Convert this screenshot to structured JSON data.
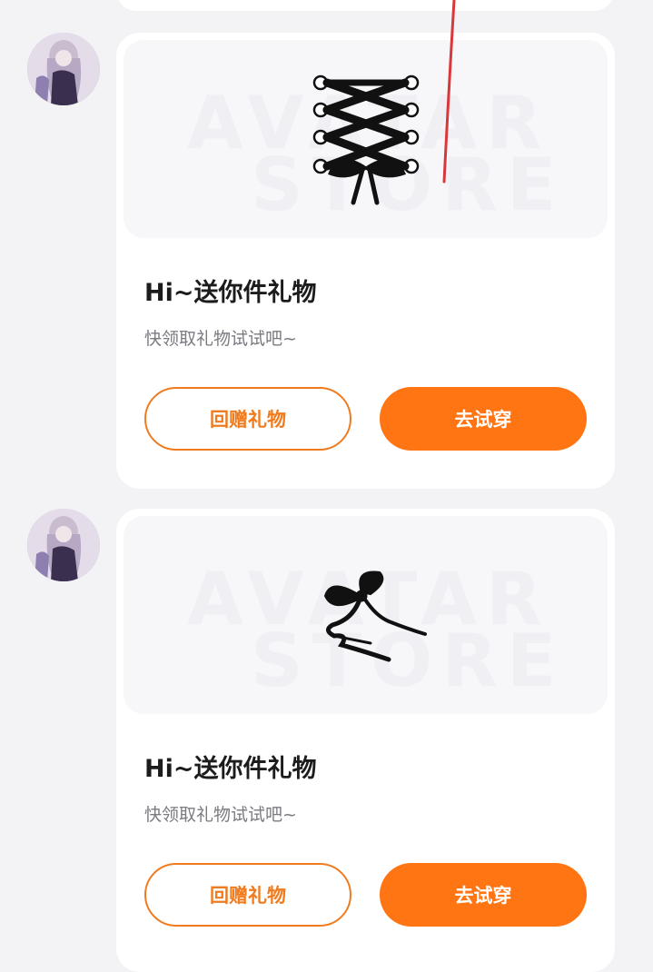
{
  "messages": [
    {
      "avatar_icon": "user-avatar",
      "item_icon": "corset-lace-icon",
      "title": "Hi~送你件礼物",
      "subtitle": "快领取礼物试试吧~",
      "watermark_line1": "AVATAR",
      "watermark_line2": "STORE",
      "return_gift_label": "回赠礼物",
      "try_on_label": "去试穿"
    },
    {
      "avatar_icon": "user-avatar",
      "item_icon": "black-ribbon-bow-icon",
      "title": "Hi~送你件礼物",
      "subtitle": "快领取礼物试试吧~",
      "watermark_line1": "AVATAR",
      "watermark_line2": "STORE",
      "return_gift_label": "回赠礼物",
      "try_on_label": "去试穿"
    }
  ],
  "colors": {
    "accent": "#ff7413",
    "outline": "#f07b1e",
    "page_bg": "#f3f3f6",
    "card_bg": "#ffffff"
  }
}
